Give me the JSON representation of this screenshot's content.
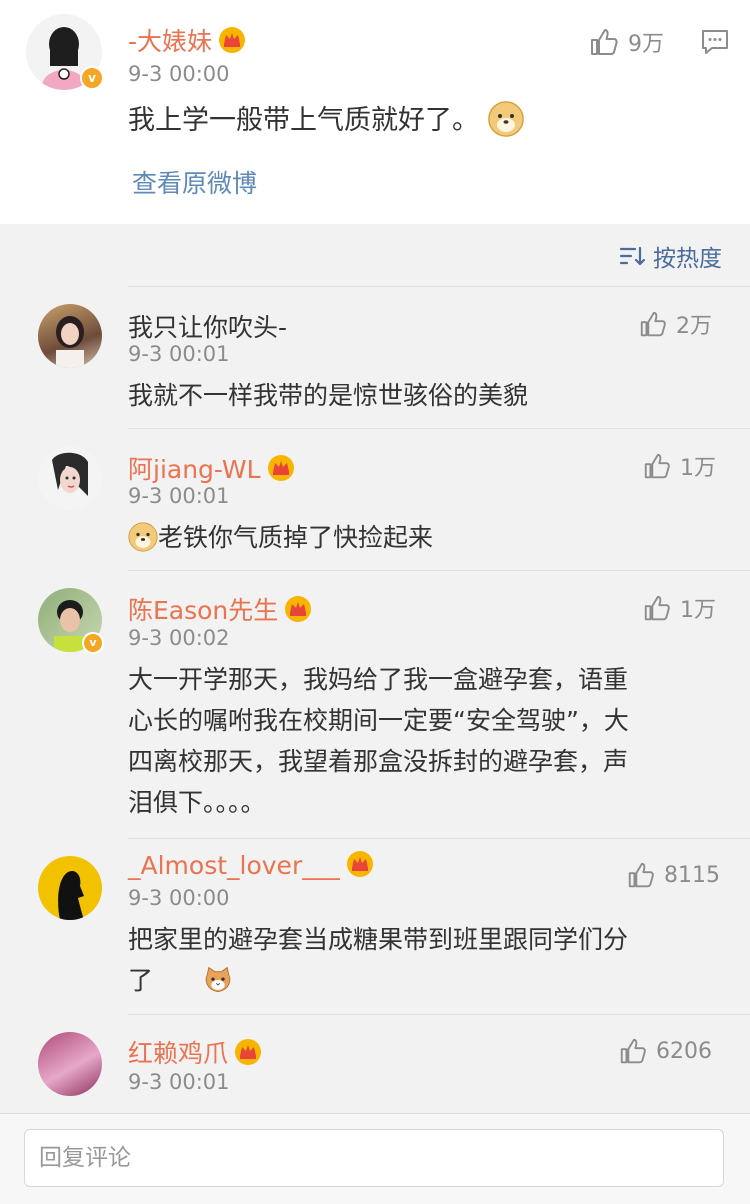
{
  "post": {
    "author": "-大婊妹",
    "time": "9-3 00:00",
    "text": "我上学一般带上气质就好了。",
    "likes": "9万",
    "view_original": "查看原微博"
  },
  "sort_label": "按热度",
  "comments": [
    {
      "name": "我只让你吹头-",
      "time": "9-3 00:01",
      "likes": "2万",
      "text": "我就不一样我带的是惊世骇俗的美貌"
    },
    {
      "name": "阿jiang-WL",
      "time": "9-3 00:01",
      "likes": "1万",
      "text": "老铁你气质掉了快捡起来"
    },
    {
      "name": "陈Eason先生",
      "time": "9-3 00:02",
      "likes": "1万",
      "text_lines": [
        "大一开学那天，我妈给了我一盒避孕套，语重",
        "心长的嘱咐我在校期间一定要“安全驾驶”，大",
        "四离校那天，我望着那盒没拆封的避孕套，声",
        "泪俱下。。。。"
      ]
    },
    {
      "name": "_Almost_lover___",
      "time": "9-3 00:00",
      "likes": "8115",
      "text_lines": [
        "把家里的避孕套当成糖果带到班里跟同学们分",
        "了"
      ]
    },
    {
      "name": "红赖鸡爪",
      "time": "9-3 00:01",
      "likes": "6206"
    }
  ],
  "reply": {
    "placeholder": "回复评论"
  },
  "colors": {
    "name": "#eb7350",
    "link": "#5f89b6",
    "muted": "#8c8c8c",
    "text": "#333333"
  }
}
